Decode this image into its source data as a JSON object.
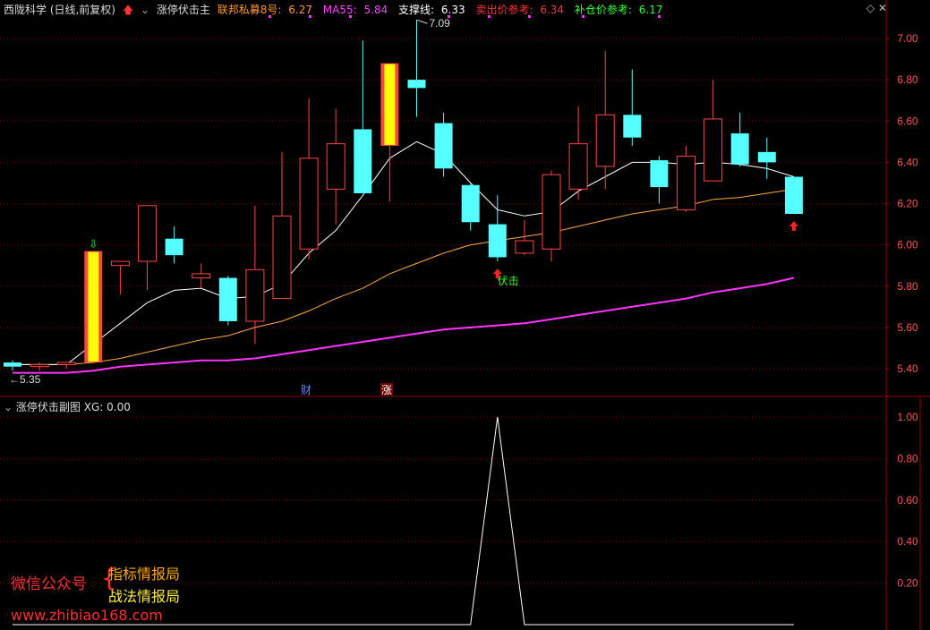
{
  "header": {
    "stock_title": "西陇科学 (日线,前复权)",
    "indicator_name": "涨停伏击主",
    "items": [
      {
        "label": "联邦私募8号:",
        "value": "6.27",
        "color": "#ff9933"
      },
      {
        "label": "MA55:",
        "value": "5.84",
        "color": "#ff44ff"
      },
      {
        "label": "支撑线:",
        "value": "6.33",
        "color": "#ffffff"
      },
      {
        "label": "卖出价参考:",
        "value": "6.34",
        "color": "#ff3333"
      },
      {
        "label": "补仓价参考:",
        "value": "6.17",
        "color": "#33ff33"
      }
    ]
  },
  "sub_header": {
    "indicator_name": "涨停伏击副图",
    "xg_label": "XG:",
    "xg_value": "0.00"
  },
  "annotations": {
    "high_label": "7.09",
    "low_label": "5.35",
    "signal_label": "伏击",
    "badge_cai": "财",
    "badge_zhang": "涨"
  },
  "watermark": {
    "wechat": "微信公众号",
    "brace": "{",
    "line1": "指标情报局",
    "line2": "战法情报局",
    "url": "www.zhibiao168.com"
  },
  "colors": {
    "up": "#ff4444",
    "down": "#55ffff",
    "limit_up_fill": "#ffff00",
    "ma_white": "#ffffff",
    "ma_orange": "#ffaa44",
    "ma55": "#ff33ff",
    "grid": "#8b0000",
    "axis_text": "#ff5555"
  },
  "chart_data": [
    {
      "type": "candlestick",
      "ylim": [
        5.35,
        7.1
      ],
      "yticks": [
        "7.00",
        "6.80",
        "6.60",
        "6.40",
        "6.20",
        "6.00",
        "5.80",
        "5.60",
        "5.40"
      ],
      "candles": [
        {
          "o": 5.43,
          "h": 5.44,
          "l": 5.39,
          "c": 5.41
        },
        {
          "o": 5.41,
          "h": 5.43,
          "l": 5.39,
          "c": 5.42
        },
        {
          "o": 5.42,
          "h": 5.43,
          "l": 5.4,
          "c": 5.43
        },
        {
          "o": 5.43,
          "h": 5.97,
          "l": 5.43,
          "c": 5.97,
          "limit": true
        },
        {
          "o": 5.9,
          "h": 5.92,
          "l": 5.76,
          "c": 5.92
        },
        {
          "o": 5.92,
          "h": 6.11,
          "l": 5.78,
          "c": 6.19
        },
        {
          "o": 6.03,
          "h": 6.09,
          "l": 5.91,
          "c": 5.95
        },
        {
          "o": 5.84,
          "h": 5.91,
          "l": 5.79,
          "c": 5.86
        },
        {
          "o": 5.84,
          "h": 5.85,
          "l": 5.61,
          "c": 5.63
        },
        {
          "o": 5.63,
          "h": 6.19,
          "l": 5.52,
          "c": 5.88
        },
        {
          "o": 5.74,
          "h": 6.45,
          "l": 5.74,
          "c": 6.14
        },
        {
          "o": 5.98,
          "h": 6.71,
          "l": 5.93,
          "c": 6.42
        },
        {
          "o": 6.27,
          "h": 6.66,
          "l": 6.1,
          "c": 6.49
        },
        {
          "o": 6.56,
          "h": 6.99,
          "l": 6.25,
          "c": 6.25
        },
        {
          "o": 6.48,
          "h": 6.88,
          "l": 6.21,
          "c": 6.88,
          "limit": true
        },
        {
          "o": 6.8,
          "h": 7.09,
          "l": 6.62,
          "c": 6.76
        },
        {
          "o": 6.59,
          "h": 6.64,
          "l": 6.33,
          "c": 6.37
        },
        {
          "o": 6.29,
          "h": 6.3,
          "l": 6.07,
          "c": 6.11
        },
        {
          "o": 6.1,
          "h": 6.24,
          "l": 5.92,
          "c": 5.94
        },
        {
          "o": 5.96,
          "h": 6.12,
          "l": 5.95,
          "c": 6.02
        },
        {
          "o": 5.98,
          "h": 6.36,
          "l": 5.92,
          "c": 6.34
        },
        {
          "o": 6.27,
          "h": 6.67,
          "l": 6.22,
          "c": 6.49
        },
        {
          "o": 6.38,
          "h": 6.94,
          "l": 6.27,
          "c": 6.63
        },
        {
          "o": 6.63,
          "h": 6.85,
          "l": 6.48,
          "c": 6.52
        },
        {
          "o": 6.41,
          "h": 6.43,
          "l": 6.2,
          "c": 6.28
        },
        {
          "o": 6.17,
          "h": 6.48,
          "l": 6.16,
          "c": 6.43
        },
        {
          "o": 6.31,
          "h": 6.8,
          "l": 6.31,
          "c": 6.61
        },
        {
          "o": 6.54,
          "h": 6.64,
          "l": 6.38,
          "c": 6.39
        },
        {
          "o": 6.45,
          "h": 6.52,
          "l": 6.32,
          "c": 6.4
        },
        {
          "o": 6.33,
          "h": 6.33,
          "l": 6.15,
          "c": 6.15
        }
      ],
      "ma_white": [
        5.42,
        5.42,
        5.42,
        5.52,
        5.62,
        5.72,
        5.78,
        5.79,
        5.74,
        5.75,
        5.81,
        5.96,
        6.07,
        6.24,
        6.42,
        6.5,
        6.44,
        6.3,
        6.17,
        6.14,
        6.16,
        6.26,
        6.33,
        6.4,
        6.4,
        6.39,
        6.4,
        6.39,
        6.37,
        6.33
      ],
      "ma_orange": [
        5.42,
        5.42,
        5.42,
        5.43,
        5.45,
        5.48,
        5.51,
        5.54,
        5.56,
        5.6,
        5.63,
        5.68,
        5.74,
        5.79,
        5.86,
        5.91,
        5.96,
        6.0,
        6.02,
        6.04,
        6.06,
        6.09,
        6.12,
        6.15,
        6.17,
        6.19,
        6.22,
        6.23,
        6.25,
        6.27
      ],
      "ma55": [
        5.38,
        5.38,
        5.38,
        5.39,
        5.41,
        5.42,
        5.43,
        5.44,
        5.44,
        5.45,
        5.47,
        5.49,
        5.51,
        5.53,
        5.55,
        5.57,
        5.59,
        5.6,
        5.61,
        5.62,
        5.64,
        5.66,
        5.68,
        5.7,
        5.72,
        5.74,
        5.77,
        5.79,
        5.81,
        5.84
      ],
      "down_arrow_index": 3,
      "up_arrow_indices": [
        18,
        29
      ]
    },
    {
      "type": "line",
      "name": "XG",
      "ylim": [
        0,
        1.05
      ],
      "yticks": [
        "1.00",
        "0.80",
        "0.60",
        "0.40",
        "0.20"
      ],
      "values": [
        0,
        0,
        0,
        0,
        0,
        0,
        0,
        0,
        0,
        0,
        0,
        0,
        0,
        0,
        0,
        0,
        0,
        0,
        1,
        0,
        0,
        0,
        0,
        0,
        0,
        0,
        0,
        0,
        0,
        0
      ]
    }
  ]
}
